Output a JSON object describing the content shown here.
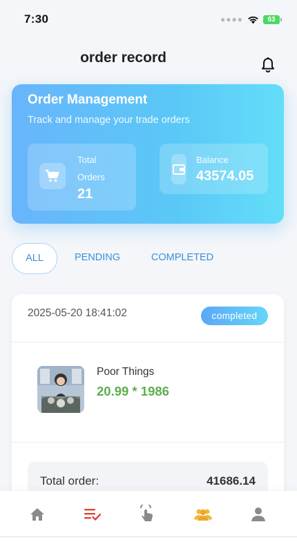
{
  "status_bar": {
    "time": "7:30",
    "battery": "63"
  },
  "header": {
    "title": "order record"
  },
  "summary": {
    "title": "Order Management",
    "subtitle": "Track and manage your trade orders",
    "total_orders_label": "Total Orders",
    "total_orders_value": "21",
    "balance_label": "Balance",
    "balance_value": "43574.05"
  },
  "tabs": [
    {
      "label": "ALL",
      "active": true
    },
    {
      "label": "PENDING",
      "active": false
    },
    {
      "label": "COMPLETED",
      "active": false
    }
  ],
  "orders": [
    {
      "datetime": "2025-05-20 18:41:02",
      "status": "completed",
      "product_name": "Poor Things",
      "price_line": "20.99 * 1986",
      "total_label": "Total order:",
      "total_value": "41686.14"
    }
  ],
  "bottom_nav": [
    {
      "name": "home",
      "icon": "home-icon",
      "color": "#8a8a8a"
    },
    {
      "name": "orders",
      "icon": "order-list-check-icon",
      "color": "#e0453a"
    },
    {
      "name": "trade",
      "icon": "tap-hand-icon",
      "color": "#8a8a8a"
    },
    {
      "name": "team",
      "icon": "team-icon",
      "color": "#f2b83a"
    },
    {
      "name": "profile",
      "icon": "user-icon",
      "color": "#8a8a8a"
    }
  ],
  "colors": {
    "accent_blue": "#5ab6f8",
    "price_green": "#5cae4c",
    "active_nav_red": "#e0453a",
    "team_gold": "#f2b83a"
  }
}
